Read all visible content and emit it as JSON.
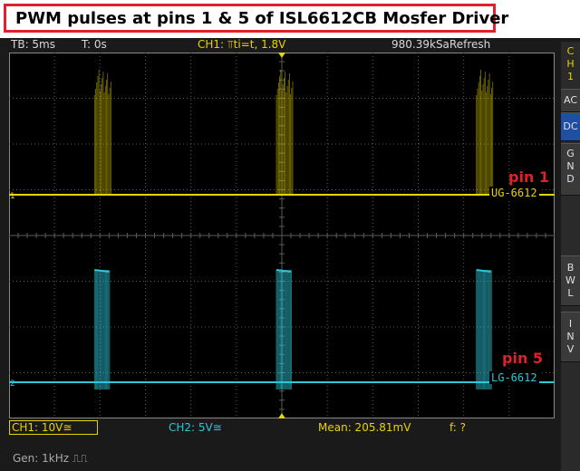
{
  "banner": {
    "title": "PWM pulses at pins 1 & 5 of ISL6612CB Mosfer Driver"
  },
  "status": {
    "timebase": "TB: 5ms",
    "trigger_time": "T: 0s",
    "trigger_info": "CH1: ⫪ti=t, 1.8V",
    "sample_rate": "980.39kSaRefresh"
  },
  "sidebar": {
    "channel_label": [
      "C",
      "H",
      "1"
    ],
    "buttons": [
      {
        "label": "AC",
        "active": false
      },
      {
        "label": "DC",
        "active": true
      },
      {
        "label": "G N D",
        "active": false
      },
      {
        "label": "B W L",
        "active": false
      },
      {
        "label": "I N V",
        "active": false
      }
    ]
  },
  "traces": {
    "ch1": {
      "name": "UG-6612",
      "color": "#e8d400",
      "pin_label": "pin 1"
    },
    "ch2": {
      "name": "LG-6612",
      "color": "#2ec7d8",
      "pin_label": "pin 5"
    },
    "pulse_times_div": [
      2,
      6,
      10.4
    ]
  },
  "bottom": {
    "ch1_scale": "CH1: 10V≅",
    "ch2_scale": "CH2: 5V≅",
    "mean": "Mean: 205.81mV",
    "freq": "f: ?"
  },
  "footer": {
    "generator": "Gen: 1kHz ⎍⎍"
  },
  "colors": {
    "grid": "#5a5a5a",
    "ch1": "#e8d400",
    "ch2": "#2ec7d8",
    "banner_border": "#e0202a"
  }
}
